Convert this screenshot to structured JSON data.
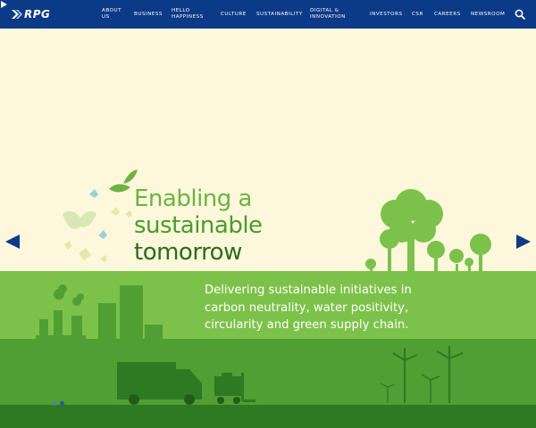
{
  "brand": {
    "logo_text": "RPG",
    "primary_color": "#0b3a87"
  },
  "nav": {
    "items": [
      {
        "id": "about",
        "lines": [
          "ABOUT",
          "US"
        ]
      },
      {
        "id": "business",
        "lines": [
          "BUSINESS"
        ]
      },
      {
        "id": "hello-happiness",
        "lines": [
          "HELLO",
          "HAPPINESS"
        ]
      },
      {
        "id": "culture",
        "lines": [
          "CULTURE"
        ]
      },
      {
        "id": "sustainability",
        "lines": [
          "SUSTAINABILITY"
        ]
      },
      {
        "id": "digital",
        "lines": [
          "DIGITAL &",
          "INNOVATION"
        ]
      },
      {
        "id": "investors",
        "lines": [
          "INVESTORS"
        ]
      },
      {
        "id": "csr",
        "lines": [
          "CSR"
        ]
      },
      {
        "id": "careers",
        "lines": [
          "CAREERS"
        ]
      },
      {
        "id": "newsroom",
        "lines": [
          "NEWSROOM"
        ]
      }
    ],
    "search_icon": "search-icon"
  },
  "hero": {
    "headline_line1": "Enabling a",
    "headline_line2": "sustainable",
    "headline_line3": "tomorrow",
    "subtext": "Delivering sustainable initiatives in carbon neutrality, water positivity, circularity and green supply chain.",
    "colors": {
      "background": "#fdf8dc",
      "light_green": "#7cc24a",
      "mid_green": "#4f9f33",
      "dark_green": "#2e7a22",
      "arrow": "#0b3a87"
    }
  },
  "carousel": {
    "slide_count": 2,
    "active_index": 1
  }
}
